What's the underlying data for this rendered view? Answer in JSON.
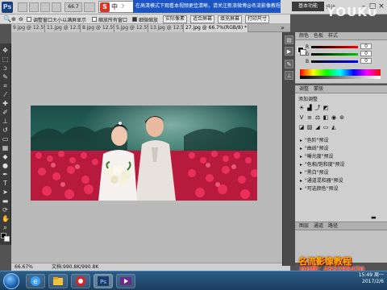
{
  "menubar": {
    "logo": "Ps",
    "zoom": "66.7",
    "ime_text": "中",
    "banner_text": "在高清模式下观看本视频更佳清晰，请关注新浪微博@名流影像教程",
    "banner2_text": "基本功能",
    "essentials": "基本功能",
    "design": "设计",
    "youku": "YOUKU"
  },
  "options": {
    "check1_label": "调整窗口大小以满屏显示",
    "check2_label": "缩放所有窗口",
    "check3_label": "细微缩放",
    "btn_actual": "实际像素",
    "btn_fit": "适合屏幕",
    "btn_fill": "填充屏幕",
    "btn_print": "打印尺寸"
  },
  "tabs": [
    "9.jpg @ 12.5%...",
    "11.jpg @ 12.5%...",
    "8.jpg @ 12.5%...",
    "5.jpg @ 12.5%...",
    "13.jpg @ 12.5%...",
    "27.jpg @ 66.7%(RGB/8) *"
  ],
  "status": {
    "zoom": "66.67%",
    "doc": "文档:990.8K/990.8K"
  },
  "color_panel": {
    "tab1": "颜色",
    "tab2": "色板",
    "tab3": "样式",
    "r_label": "R",
    "g_label": "G",
    "b_label": "B",
    "r_val": "0",
    "g_val": "0",
    "b_val": "0"
  },
  "adjustments": {
    "tab1": "调整",
    "tab2": "蒙版",
    "title": "添加调整",
    "presets": [
      "\"色阶\"预设",
      "\"曲线\"预设",
      "\"曝光度\"预设",
      "\"色相/饱和度\"预设",
      "\"黑白\"预设",
      "\"通道混和器\"预设",
      "\"可选颜色\"预设"
    ]
  },
  "layers": {
    "tab1": "图层",
    "tab2": "通道",
    "tab3": "路径"
  },
  "watermark": {
    "line1": "名流影像教程",
    "line2": "QQ群：455295470"
  },
  "clock": {
    "time": "15:49",
    "day": "周一",
    "date": "2017/2/6"
  },
  "colors": {
    "ps_dark": "#3b3b3b",
    "panel": "#cfcfcf",
    "banner": "#1b55c4",
    "flower_red": "#d0204a"
  }
}
